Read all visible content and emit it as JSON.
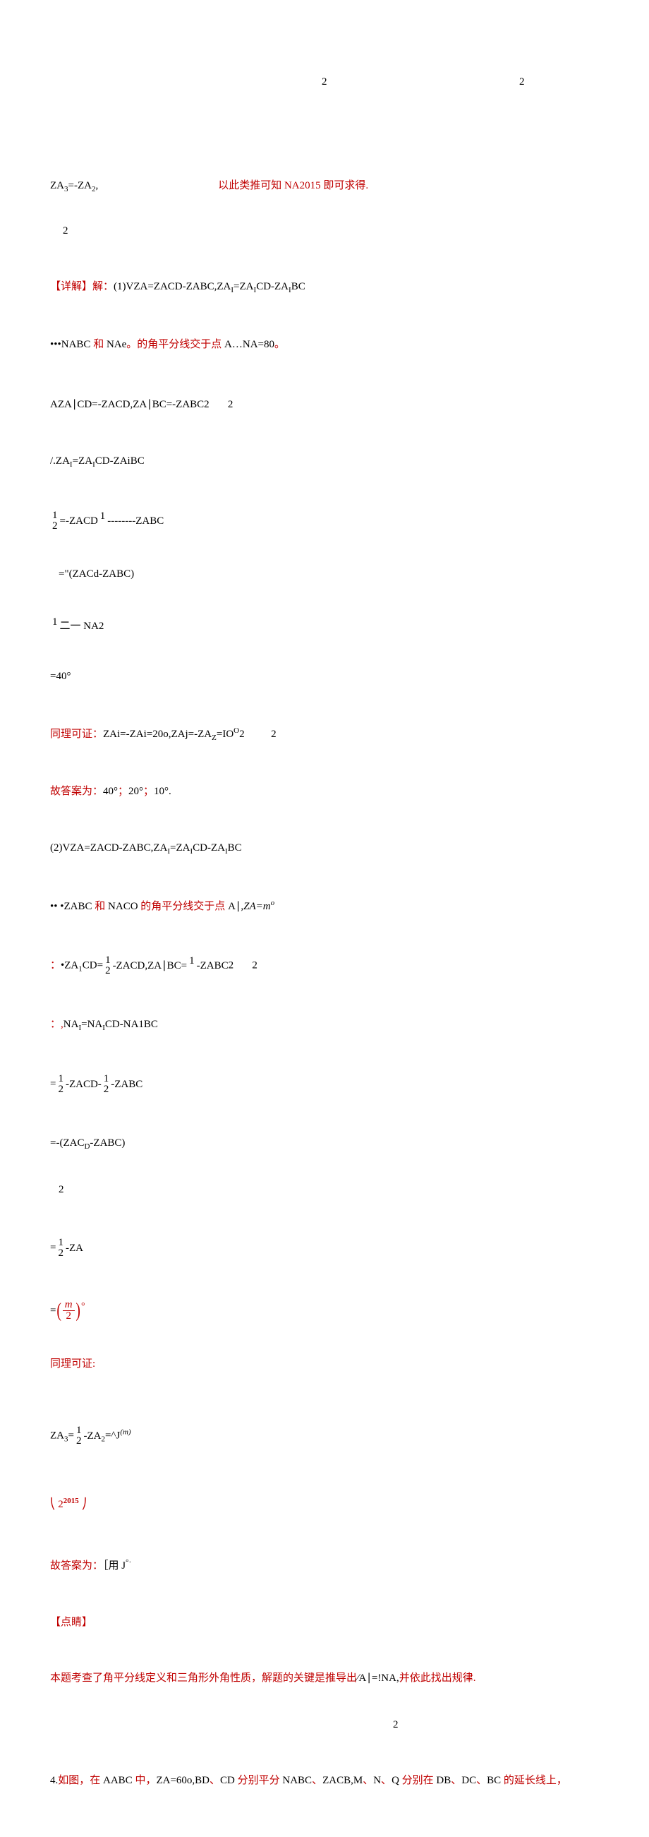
{
  "row_top": {
    "a": "2",
    "b": "2"
  },
  "l1_a": "ZA",
  "l1_sub": "3",
  "l1_b": "=-ZA",
  "l1_sub2": "2",
  "l1_c": ",",
  "l1_d": "以此类推可知 NA2015 即可求得.",
  "l1_under": "2",
  "l2_a": "【详解】解：",
  "l2_b": "(1)VZA=ZACD-ZABC,ZA",
  "l2_sub1": "I",
  "l2_c": "=ZA",
  "l2_sub2": "I",
  "l2_d": "CD-ZA",
  "l2_sub3": "I",
  "l2_e": "BC",
  "l3_a": "•••NABC",
  "l3_b": " 和 ",
  "l3_c": "NAe",
  "l3_d": "。的角平分线交于点 ",
  "l3_e": "A…NA=80",
  "l3_f": "。",
  "l4": "AZA∣CD=-ZACD,ZA∣BC=-ZABC2       2",
  "l5_a": "/.ZA",
  "l5_sub": "I",
  "l5_b": "=ZA",
  "l5_sub2": "I",
  "l5_c": "CD-ZAiBC",
  "l6_a": "=-ZACD",
  "l6_b": "--------ZABC",
  "l6_num1": "1",
  "l6_den1": "2",
  "l6_num2": "1",
  "l7": "=\"(ZACd-ZABC)",
  "l8_num": "1",
  "l8_a": "二一 NA2",
  "l9": "=40°",
  "l10_a": "同理可证：",
  "l10_b": "ZAi=-ZAi=20o,ZAj=-ZA",
  "l10_c": "Z",
  "l10_d": "=IO",
  "l10_e": "O",
  "l10_f": "2          2",
  "l11_a": "故答案为：",
  "l11_b": "40°",
  "l11_c": "；",
  "l11_d": "20°",
  "l11_e": "；",
  "l11_f": "10°",
  "l11_g": ".",
  "l12_a": "(2)VZA=ZACD-ZABC,ZA",
  "l12_sub1": "I",
  "l12_b": "=ZA",
  "l12_sub2": "I",
  "l12_c": "CD-ZA",
  "l12_sub3": "I",
  "l12_d": "BC",
  "l13_a": "•• •ZABC",
  "l13_b": " 和 ",
  "l13_c": "NACO",
  "l13_d": " 的角平分线交于点 ",
  "l13_e": "A∣,",
  "l13_f": "ZA=m",
  "l13_g": "o",
  "l14_a": "：",
  "l14_b": "•ZA",
  "l14_sub1": "1",
  "l14_c": "CD=-ZACD,ZA∣BC=-ZABC",
  "l14_num1": "1",
  "l14_den1": "2",
  "l14_num2": "1",
  "l14_e": "2       2",
  "l15_a": "：,",
  "l15_b": "NA",
  "l15_c": "I",
  "l15_d": "=NA",
  "l15_e": "I",
  "l15_f": "CD-NA1BC",
  "l16_a": "=-ZACD--ZABC",
  "l16_num1": "1",
  "l16_den1": "2",
  "l16_num2": "1",
  "l16_den2": "2",
  "l17_a": "=-(ZAC",
  "l17_b": "D",
  "l17_c": "-ZABC)",
  "l17_den": "2",
  "l18_a": "=-ZA",
  "l18_num": "1",
  "l18_den": "2",
  "l19_a": "=",
  "l19_frac_num": "m",
  "l19_frac_den": "2",
  "l19_b": "°",
  "l20": "同理可证:",
  "l21_a": "ZA",
  "l21_sub1": "3",
  "l21_b": "=-ZA",
  "l21_sub2": "2",
  "l21_c": "=^J",
  "l21_num": "1",
  "l21_den": "2",
  "l21_sup": "(m)",
  "l22_a": "(",
  "l22_b": "J",
  "l22_base": "2",
  "l22_exp": "2015",
  "l23_a": "故答案为：",
  "l23_b": "［用 ",
  "l23_c": "J",
  "l23_d": "°·",
  "l24": "【点睛】",
  "l25_a": "本题考查了角平分线定义和三角形外角性质，解题的关键是推导出",
  "l25_b": "∕A∣=!NA,",
  "l25_c": "并依此找出规律.",
  "l25_under": "2",
  "l26_a": "4.",
  "l26_b": "如图，在 ",
  "l26_c": "AABC",
  "l26_d": " 中，",
  "l26_e": "ZA=60o,BD",
  "l26_f": "、",
  "l26_g": "CD",
  "l26_h": " 分别平分 ",
  "l26_i": "NABC",
  "l26_j": "、",
  "l26_k": "ZACB,M",
  "l26_l": "、",
  "l26_m": "N",
  "l26_n": "、",
  "l26_o": "Q",
  "l26_p": " 分别在 ",
  "l26_q": "DB",
  "l26_r": "、",
  "l26_s": "DC",
  "l26_t": "、",
  "l26_u": "BC",
  "l26_v": " 的延长线上，"
}
